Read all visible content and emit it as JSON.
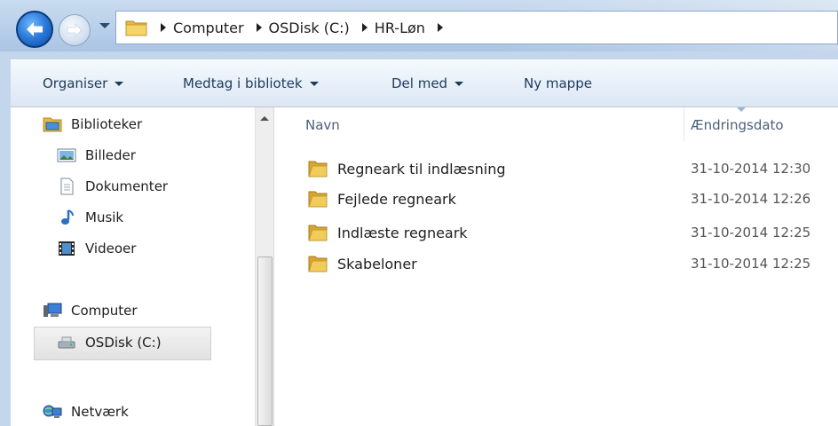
{
  "address_bar": {
    "breadcrumbs": [
      "Computer",
      "OSDisk (C:)",
      "HR-Løn"
    ]
  },
  "command_bar": {
    "organise": "Organiser",
    "include_in_library": "Medtag i bibliotek",
    "share_with": "Del med",
    "new_folder": "Ny mappe"
  },
  "nav": {
    "libraries": "Biblioteker",
    "pictures": "Billeder",
    "documents": "Dokumenter",
    "music": "Musik",
    "videos": "Videoer",
    "computer": "Computer",
    "osdisk": "OSDisk (C:)",
    "network": "Netværk"
  },
  "file_list": {
    "columns": {
      "name": "Navn",
      "modified": "Ændringsdato"
    },
    "rows": [
      {
        "name": "Regneark til indlæsning",
        "modified": "31-10-2014 12:30"
      },
      {
        "name": "Fejlede regneark",
        "modified": "31-10-2014 12:26"
      },
      {
        "name": "Indlæste regneark",
        "modified": "31-10-2014 12:25"
      },
      {
        "name": "Skabeloner",
        "modified": "31-10-2014 12:25"
      }
    ]
  },
  "colors": {
    "accent": "#2a78d6",
    "folder": "#e8b93c"
  }
}
